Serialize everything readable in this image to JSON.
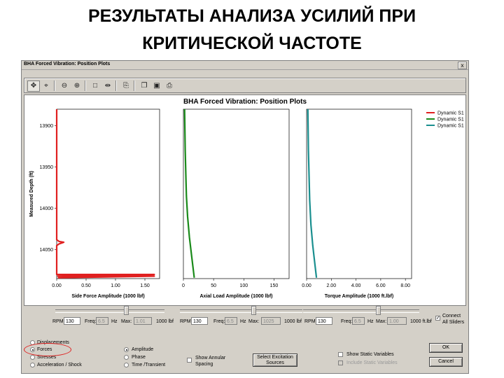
{
  "slide": {
    "title_line1": "РЕЗУЛЬТАТЫ АНАЛИЗА УСИЛИЙ ПРИ",
    "title_line2": "КРИТИЧЕСКОЙ ЧАСТОТЕ"
  },
  "window": {
    "title": "BHA Forced Vibration: Position Plots",
    "close_label": "x"
  },
  "toolbar": {
    "icons": [
      "move-icon",
      "zoom-box-icon",
      "zoom-out-icon",
      "zoom-in-icon",
      "blank-icon",
      "split-icon",
      "export-icon",
      "copy-icon",
      "save-icon",
      "print-icon"
    ]
  },
  "plot": {
    "title": "BHA Forced Vibration: Position Plots",
    "ylabel": "Measured Depth (ft)",
    "legend": [
      "Dynamic S1",
      "Dynamic S1",
      "Dynamic S1"
    ]
  },
  "chart_data": [
    {
      "type": "line",
      "title": "BHA Forced Vibration: Position Plots",
      "xlabel": "Side Force Amplitude (1000 lbf)",
      "ylabel": "Measured Depth (ft)",
      "xlim": [
        0,
        1.75
      ],
      "ylim": [
        13880,
        14085
      ],
      "xticks": [
        "0.00",
        "0.50",
        "1.00",
        "1.50"
      ],
      "yticks": [
        "13900",
        "13950",
        "14000",
        "14050"
      ],
      "color": "#e02020",
      "series": [
        {
          "name": "Dynamic S1",
          "x": [
            0.0,
            0.0,
            0.0,
            0.0,
            0.04,
            0.12,
            0.04,
            0.0,
            0.0,
            0.0,
            0.3,
            1.66,
            0.02,
            1.66,
            0.02
          ],
          "y": [
            13880,
            13950,
            14000,
            14038,
            14040,
            14041,
            14043,
            14045,
            14065,
            14080,
            14080,
            14080,
            14082,
            14082,
            14084
          ]
        }
      ]
    },
    {
      "type": "line",
      "xlabel": "Axial Load Amplitude (1000 lbf)",
      "xlim": [
        0,
        175
      ],
      "ylim": [
        13880,
        14085
      ],
      "xticks": [
        "0",
        "50",
        "100",
        "150"
      ],
      "color": "#1a8a1a",
      "series": [
        {
          "name": "Dynamic S1",
          "x": [
            2,
            3,
            4,
            5,
            7,
            10,
            14,
            18
          ],
          "y": [
            13880,
            13930,
            13960,
            13985,
            14010,
            14035,
            14060,
            14084
          ]
        }
      ]
    },
    {
      "type": "line",
      "xlabel": "Torque Amplitude (1000 ft.lbf)",
      "xlim": [
        0,
        8.5
      ],
      "ylim": [
        13880,
        14085
      ],
      "xticks": [
        "0.00",
        "2.00",
        "4.00",
        "6.00",
        "8.00"
      ],
      "color": "#1a8f8f",
      "series": [
        {
          "name": "Dynamic S1",
          "x": [
            0.1,
            0.15,
            0.2,
            0.25,
            0.35,
            0.5,
            0.65,
            0.8
          ],
          "y": [
            13880,
            13930,
            13960,
            13990,
            14020,
            14045,
            14065,
            14084
          ]
        }
      ]
    }
  ],
  "controls": {
    "rpm_label": "RPM:",
    "freq_label": "Freq:",
    "hz_label": "Hz",
    "max_label": "Max:",
    "panels": [
      {
        "rpm": "130",
        "freq": "6.5",
        "max": "1.01",
        "unit": "1000 lbf"
      },
      {
        "rpm": "130",
        "freq": "6.5",
        "max": "1025",
        "unit": "1000 lbf"
      },
      {
        "rpm": "130",
        "freq": "6.5",
        "max": "1.00",
        "unit": "1000 ft.lbf"
      }
    ],
    "connect_label_1": "Connect",
    "connect_label_2": "All Sliders",
    "result_types": [
      "Displacements",
      "Forces",
      "Stresses",
      "Acceleration / Shock"
    ],
    "result_selected": "Forces",
    "plot_modes": [
      "Amplitude",
      "Phase",
      "Time /Transient"
    ],
    "plot_selected": "Amplitude",
    "show_annular_1": "Show Annular",
    "show_annular_2": "Spacing",
    "select_excitation_1": "Select Excitation",
    "select_excitation_2": "Sources",
    "show_static": "Show Static Variables",
    "include_static": "Include Static Variables",
    "ok": "OK",
    "cancel": "Cancel"
  }
}
